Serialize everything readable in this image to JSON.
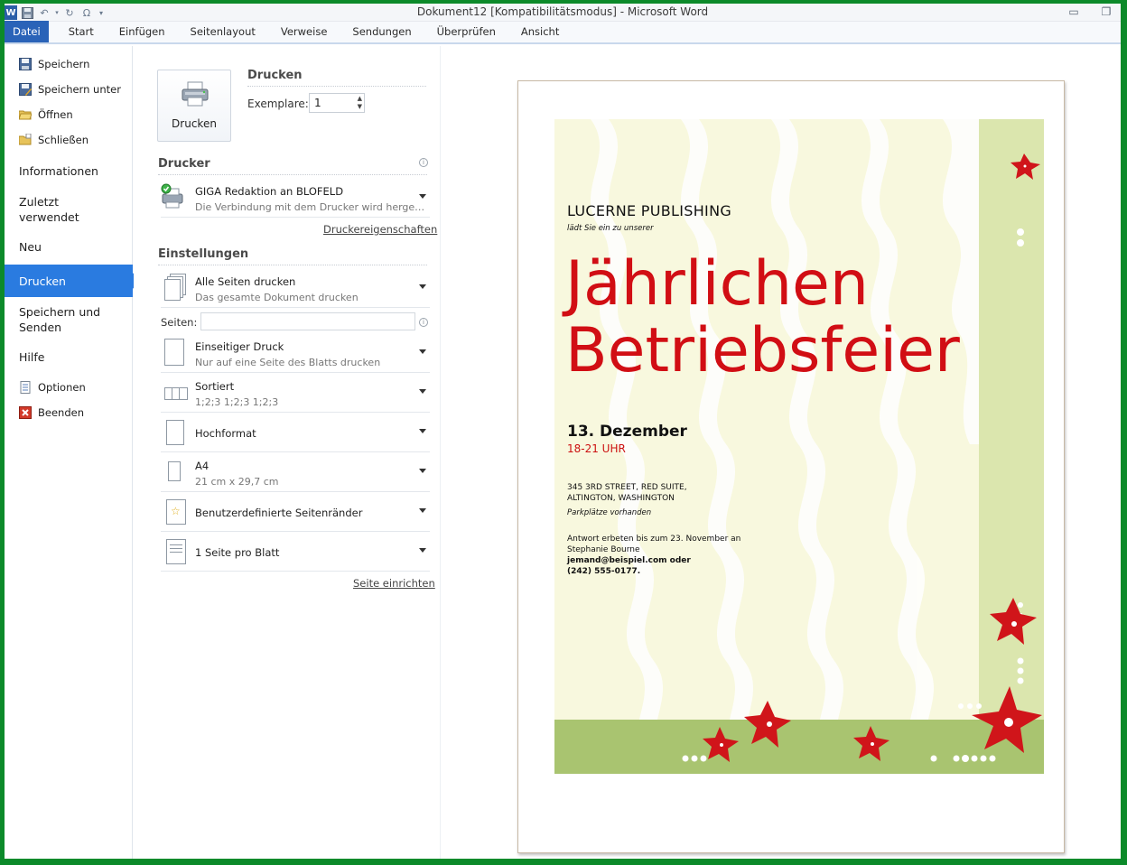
{
  "titlebar": {
    "app_letter": "W",
    "title": "Dokument12 [Kompatibilitätsmodus]  -  Microsoft Word",
    "undo": "↶",
    "redo": "↻",
    "omega": "Ω"
  },
  "tabs": [
    "Datei",
    "Start",
    "Einfügen",
    "Seitenlayout",
    "Verweise",
    "Sendungen",
    "Überprüfen",
    "Ansicht"
  ],
  "nav": {
    "commands": [
      "Speichern",
      "Speichern unter",
      "Öffnen",
      "Schließen"
    ],
    "items": {
      "info": "Informationen",
      "recent_1": "Zuletzt",
      "recent_2": "verwendet",
      "new": "Neu",
      "print": "Drucken",
      "send_1": "Speichern und",
      "send_2": "Senden",
      "help": "Hilfe"
    },
    "bottom_commands": [
      "Optionen",
      "Beenden"
    ]
  },
  "print": {
    "button_label": "Drucken",
    "section_title": "Drucken",
    "copies_label": "Exemplare:",
    "copies_value": "1",
    "printer_title": "Drucker",
    "printer_name": "GIGA Redaktion an BLOFELD",
    "printer_status": "Die Verbindung mit dem Drucker wird herge…",
    "printer_properties": "Druckereigenschaften",
    "settings_title": "Einstellungen",
    "pages_label": "Seiten:",
    "pages_value": "",
    "page_setup": "Seite einrichten",
    "settings": [
      {
        "t1": "Alle Seiten drucken",
        "t2": "Das gesamte Dokument drucken"
      },
      {
        "t1": "Einseitiger Druck",
        "t2": "Nur auf eine Seite des Blatts drucken"
      },
      {
        "t1": "Sortiert",
        "t2": "1;2;3    1;2;3    1;2;3"
      },
      {
        "t1": "Hochformat",
        "t2": ""
      },
      {
        "t1": "A4",
        "t2": "21  cm x 29,7  cm"
      },
      {
        "t1": "Benutzerdefinierte Seitenränder",
        "t2": ""
      },
      {
        "t1": "1 Seite pro Blatt",
        "t2": ""
      }
    ]
  },
  "document": {
    "publisher": "LUCERNE PUBLISHING",
    "invite": "lädt Sie ein zu unserer",
    "headline_1": "Jährlichen",
    "headline_2": "Betriebsfeier",
    "date": "13. Dezember",
    "time": "18-21  UHR",
    "address_1": "345 3RD STREET,  RED SUITE,",
    "address_2": "ALTINGTON, WASHINGTON",
    "parking": "Parkplätze  vorhanden",
    "rsvp_1": "Antwort  erbeten bis zum 23.  November  an",
    "rsvp_2": "Stephanie Bourne",
    "rsvp_3": "jemand@beispiel.com oder",
    "rsvp_4": "(242) 555-0177."
  },
  "colors": {
    "file_tab": "#2a63b8",
    "nav_active": "#2a7be0",
    "headline_red": "#d10e14",
    "flower_red": "#d0151a",
    "green_band": "#a9c470",
    "pale_green": "#dbe6ae",
    "cream": "#f8f8de",
    "frame_green": "#0c8a2a"
  }
}
